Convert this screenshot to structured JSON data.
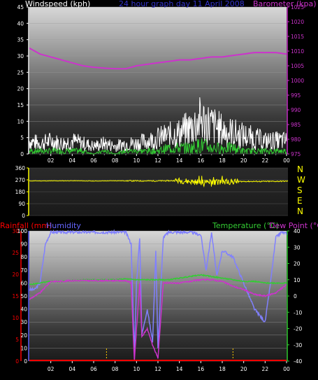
{
  "chart_data": [
    {
      "type": "line",
      "title": "24 hour graph day 11 April 2008",
      "left_axis_label": "Windspeed (kph)",
      "right_axis_label": "Barometer (kpa)",
      "xticks": [
        "02",
        "04",
        "06",
        "08",
        "10",
        "12",
        "14",
        "16",
        "18",
        "20",
        "22",
        "00"
      ],
      "left_ticks": [
        "0",
        "5",
        "10",
        "15",
        "20",
        "25",
        "30",
        "35",
        "40",
        "45"
      ],
      "right_ticks": [
        "975",
        "980",
        "985",
        "990",
        "995",
        "1000",
        "1005",
        "1010",
        "1015",
        "1020",
        "1025"
      ],
      "ylim_left": [
        0,
        45
      ],
      "ylim_right": [
        975,
        1025
      ],
      "colors": {
        "windspeed_avg": "#33cc33",
        "windspeed_gust": "#ffffff",
        "barometer": "#cc33cc",
        "title": "#3333cc",
        "left_label": "#ffffff",
        "right_label": "#cc33cc"
      },
      "series": [
        {
          "name": "Barometer",
          "x": [
            0,
            1,
            2,
            3,
            4,
            5,
            6,
            7,
            8,
            9,
            10,
            11,
            12,
            13,
            14,
            15,
            16,
            17,
            18,
            19,
            20,
            21,
            22,
            23,
            24
          ],
          "values": [
            1011,
            1009,
            1008,
            1007,
            1006,
            1005,
            1004.5,
            1004.2,
            1004,
            1004,
            1005,
            1005.5,
            1006,
            1006.5,
            1007,
            1007,
            1007.5,
            1008,
            1008,
            1008.5,
            1009,
            1009.5,
            1009.5,
            1009.5,
            1009
          ]
        },
        {
          "name": "Gust",
          "x": [
            0,
            1,
            2,
            3,
            4,
            5,
            6,
            7,
            8,
            9,
            10,
            11,
            12,
            13,
            14,
            15,
            16,
            17,
            18,
            19,
            20,
            21,
            22,
            23,
            24
          ],
          "values": [
            5,
            4,
            5,
            4,
            5,
            4,
            3,
            4,
            3,
            4,
            4,
            5,
            6,
            7,
            8,
            10,
            13,
            11,
            9,
            8,
            7,
            6,
            5,
            5,
            5
          ]
        },
        {
          "name": "Average",
          "x": [
            0,
            1,
            2,
            3,
            4,
            5,
            6,
            7,
            8,
            9,
            10,
            11,
            12,
            13,
            14,
            15,
            16,
            17,
            18,
            19,
            20,
            21,
            22,
            23,
            24
          ],
          "values": [
            1,
            1,
            1,
            1,
            1,
            1,
            0,
            1,
            0,
            1,
            1,
            1,
            1,
            2,
            2,
            2,
            3,
            2,
            2,
            2,
            1,
            1,
            1,
            1,
            1
          ]
        }
      ]
    },
    {
      "type": "line",
      "left_ticks": [
        "0",
        "90",
        "180",
        "270",
        "360"
      ],
      "right_letters": [
        "N",
        "W",
        "S",
        "E",
        "N"
      ],
      "ylim": [
        0,
        360
      ],
      "colors": {
        "direction": "#ffff00",
        "right_letters": "#ffff00"
      },
      "series": [
        {
          "name": "Wind direction",
          "x": [
            0,
            2,
            4,
            6,
            8,
            10,
            12,
            14,
            16,
            18,
            20,
            22,
            24
          ],
          "values": [
            262,
            262,
            263,
            261,
            263,
            262,
            262,
            264,
            250,
            255,
            258,
            258,
            260
          ]
        }
      ]
    },
    {
      "type": "line",
      "rain_label": "Rainfall (mm)",
      "humidity_label": "Humidity",
      "temp_label": "Temperature (°C)",
      "dew_label": "Dew Point (°C)",
      "xticks": [
        "02",
        "04",
        "06",
        "08",
        "10",
        "12",
        "14",
        "16",
        "18",
        "20",
        "22",
        "00"
      ],
      "rain_ticks": [
        "0",
        "5",
        "10",
        "15",
        "20",
        "25",
        "30"
      ],
      "humidity_ticks": [
        "0",
        "10",
        "20",
        "30",
        "40",
        "50",
        "60",
        "70",
        "80",
        "90",
        "100"
      ],
      "temp_ticks": [
        "-40",
        "-30",
        "-20",
        "-10",
        "0",
        "10",
        "20",
        "30",
        "40"
      ],
      "ylim_humidity": [
        0,
        100
      ],
      "ylim_temp": [
        -40,
        40
      ],
      "colors": {
        "rain": "#ff0000",
        "humidity": "#8080ff",
        "temperature": "#33cc33",
        "dewpoint": "#cc33cc",
        "rain_label": "#ff0000",
        "humidity_label": "#6666ff",
        "temp_label": "#33cc33",
        "dew_label": "#cc33cc"
      },
      "series": [
        {
          "name": "Humidity",
          "x": [
            0,
            0.5,
            1,
            1.5,
            2,
            4,
            6,
            8,
            9,
            9.5,
            9.8,
            10,
            10.3,
            10.5,
            11,
            11.5,
            11.8,
            12,
            12.5,
            13,
            14,
            15,
            16,
            16.5,
            17,
            17.5,
            18,
            19,
            20,
            21,
            22,
            22.5,
            23,
            23.5,
            24
          ],
          "values": [
            55,
            55,
            60,
            90,
            99,
            99,
            99,
            99,
            99,
            90,
            5,
            60,
            95,
            20,
            40,
            15,
            85,
            10,
            95,
            99,
            99,
            99,
            97,
            70,
            99,
            65,
            85,
            80,
            60,
            40,
            30,
            60,
            95,
            99,
            98
          ]
        },
        {
          "name": "Temperature",
          "x": [
            0,
            1,
            2,
            3,
            4,
            5,
            6,
            7,
            8,
            9,
            10,
            11,
            12,
            13,
            14,
            15,
            16,
            17,
            18,
            19,
            20,
            21,
            22,
            23,
            24
          ],
          "values": [
            7,
            8,
            9,
            9,
            9.5,
            10,
            10,
            10,
            10,
            10.5,
            10,
            10,
            10,
            10,
            11,
            12,
            13,
            12,
            11,
            10,
            9,
            9,
            8,
            8,
            8
          ]
        },
        {
          "name": "Dew Point",
          "x": [
            0,
            1,
            2,
            3,
            4,
            5,
            6,
            7,
            8,
            9,
            9.5,
            9.8,
            10,
            10.3,
            10.5,
            11,
            11.5,
            11.8,
            12,
            12.5,
            13,
            14,
            15,
            16,
            17,
            18,
            19,
            20,
            21,
            22,
            23,
            24
          ],
          "values": [
            -2,
            2,
            9,
            9,
            9.5,
            9.5,
            9.5,
            9.5,
            9.5,
            9.5,
            8,
            -40,
            -20,
            8,
            -25,
            -20,
            -30,
            -35,
            -38,
            8,
            8,
            8,
            9,
            10,
            10,
            9,
            6,
            4,
            1,
            0,
            2,
            7
          ]
        },
        {
          "name": "Rainfall",
          "x": [
            0,
            24
          ],
          "values": [
            0,
            0
          ]
        }
      ],
      "markers": [
        7.2,
        19.0
      ]
    }
  ]
}
